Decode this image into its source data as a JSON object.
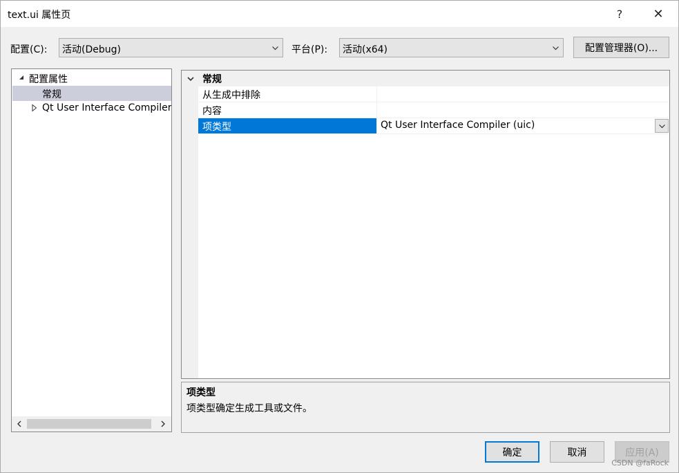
{
  "window": {
    "title": "text.ui 属性页",
    "help_glyph": "?",
    "close_glyph": "✕"
  },
  "toolbar": {
    "config_label": "配置(C):",
    "config_value": "活动(Debug)",
    "platform_label": "平台(P):",
    "platform_value": "活动(x64)",
    "config_manager_label": "配置管理器(O)..."
  },
  "tree": {
    "items": [
      {
        "label": "配置属性",
        "expander": "expanded"
      },
      {
        "label": "常规",
        "selected": true
      },
      {
        "label": "Qt User Interface Compiler (uic)",
        "expander": "collapsed"
      }
    ]
  },
  "grid": {
    "category": "常规",
    "properties": [
      {
        "name": "从生成中排除",
        "value": ""
      },
      {
        "name": "内容",
        "value": ""
      },
      {
        "name": "项类型",
        "value": "Qt User Interface Compiler (uic)",
        "selected": true
      }
    ]
  },
  "description": {
    "title": "项类型",
    "text": "项类型确定生成工具或文件。"
  },
  "buttons": {
    "ok": "确定",
    "cancel": "取消",
    "apply": "应用(A)"
  },
  "watermark": "CSDN @faRock",
  "colors": {
    "selection_blue": "#0078d7",
    "tree_selection": "#cccedb",
    "dialog_bg": "#f0f0f0"
  }
}
